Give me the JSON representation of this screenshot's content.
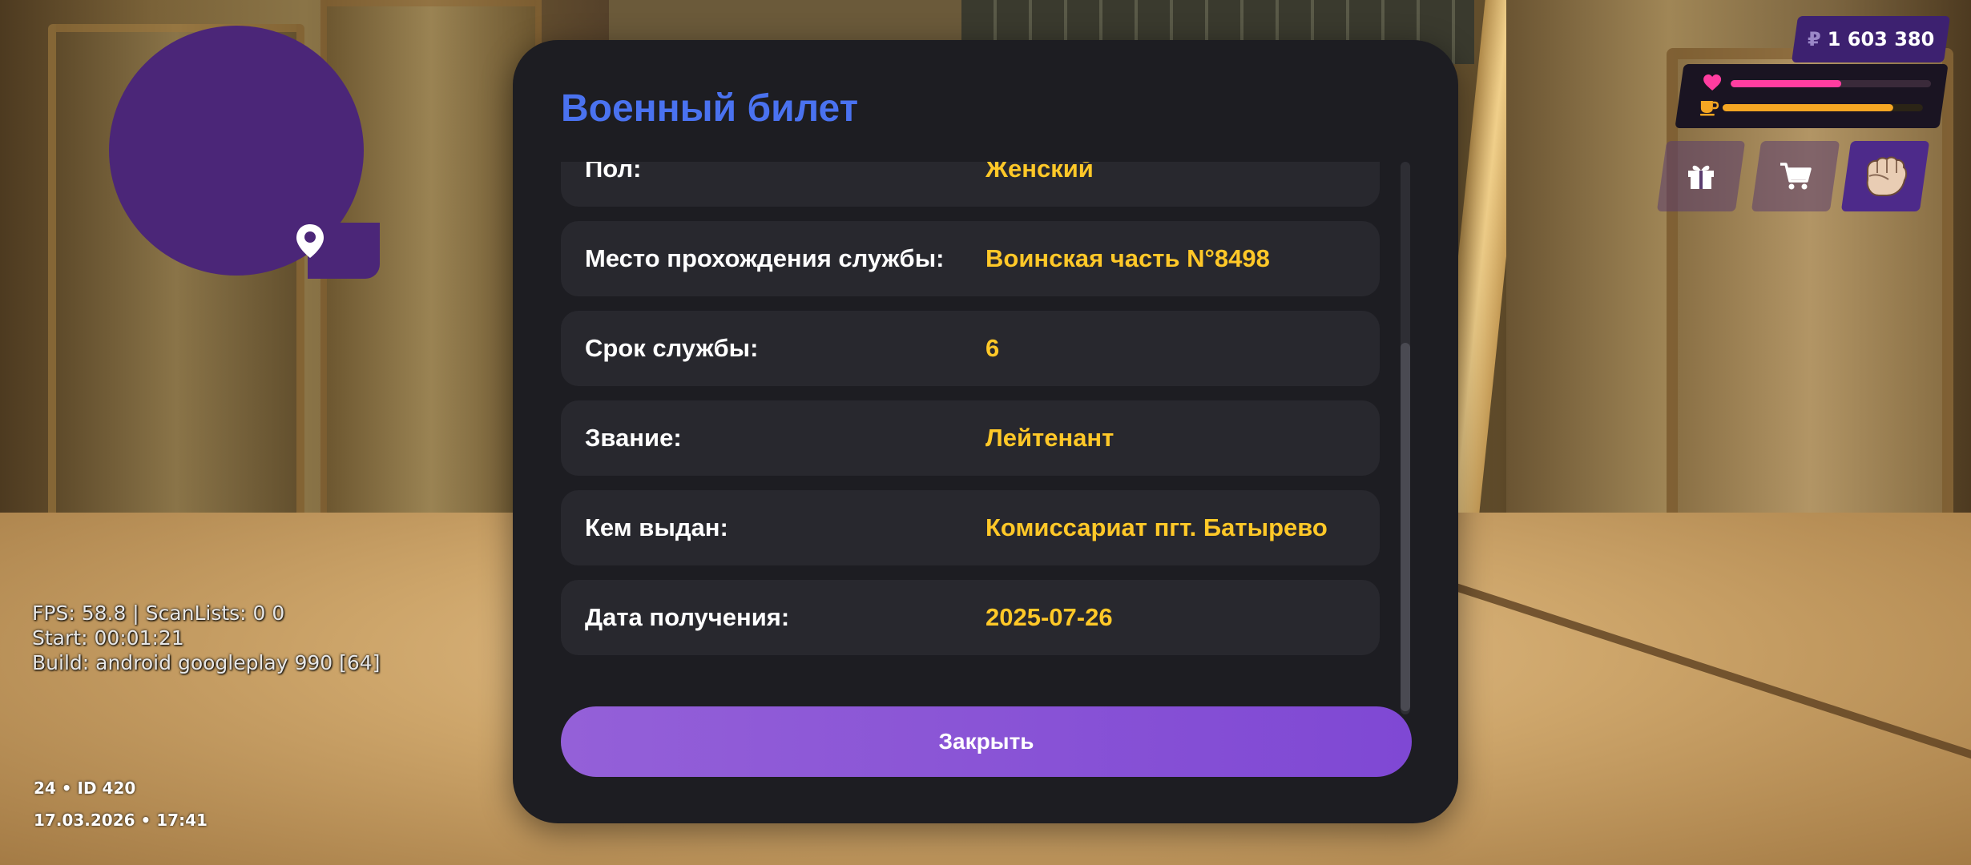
{
  "hud": {
    "money": "1 603 380",
    "currency_symbol": "₽",
    "health_level": 0.55,
    "hunger_level": 0.85,
    "debug_fps": "FPS: 58.8 | ScanLists: 0 0",
    "debug_start": "Start: 00:01:21",
    "debug_build": "Build: android googleplay 990 [64]",
    "server_id": "24 • ID 420",
    "datetime": "17.03.2026 • 17:41"
  },
  "dialog": {
    "title": "Военный билет",
    "rows": [
      {
        "label": "Пол:",
        "value": "Женский"
      },
      {
        "label": "Место прохождения службы:",
        "value": "Воинская часть N°8498"
      },
      {
        "label": "Срок службы:",
        "value": "6"
      },
      {
        "label": "Звание:",
        "value": "Лейтенант"
      },
      {
        "label": "Кем выдан:",
        "value": "Комиссариат пгт. Батырево"
      },
      {
        "label": "Дата получения:",
        "value": "2025-07-26"
      }
    ],
    "close_label": "Закрыть"
  },
  "colors": {
    "title": "#4a72f0",
    "value": "#ffc828",
    "button": "#8a55d8",
    "health": "#ff3da0",
    "hunger": "#f5a623",
    "minimap": "#4b2678"
  }
}
